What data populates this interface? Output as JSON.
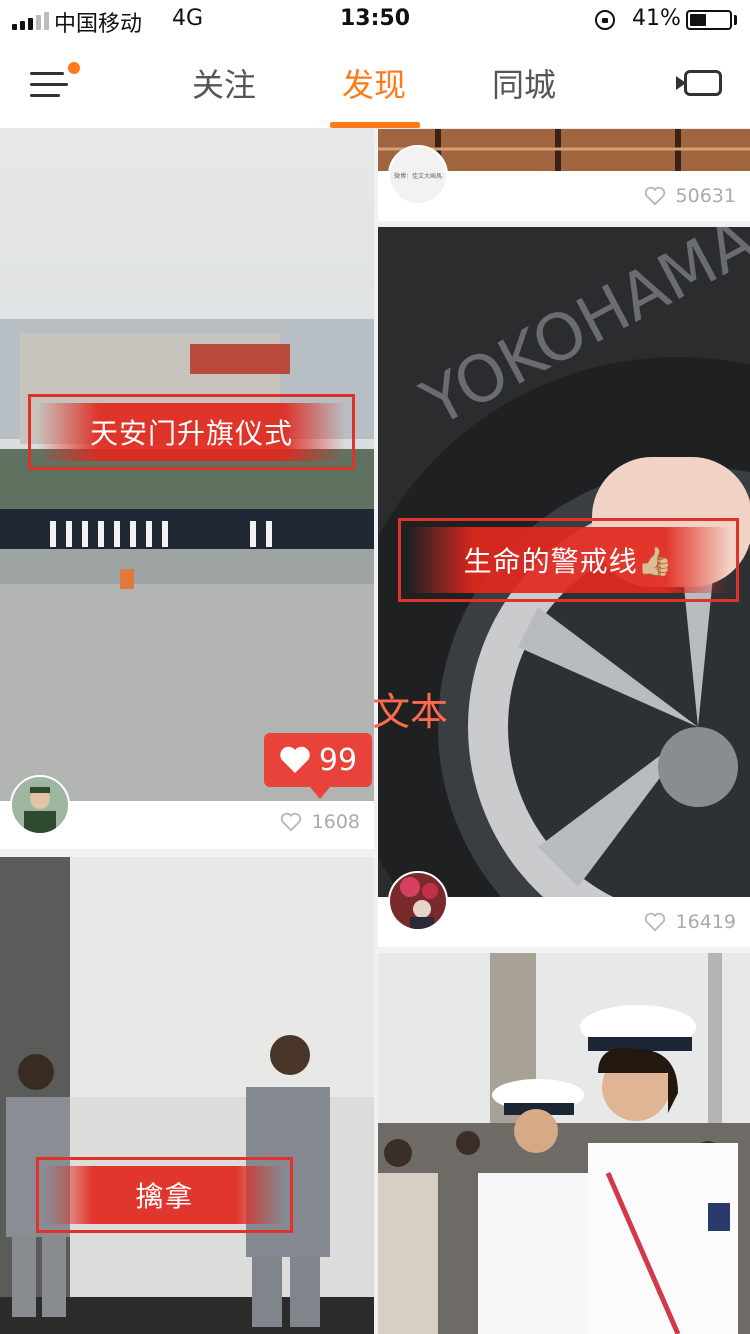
{
  "status_bar": {
    "carrier": "中国移动",
    "network": "4G",
    "time": "13:50",
    "battery_percent": "41%",
    "battery_level": 0.41
  },
  "nav": {
    "tabs": [
      {
        "label": "关注",
        "active": false
      },
      {
        "label": "发现",
        "active": true
      },
      {
        "label": "同城",
        "active": false
      }
    ],
    "accent_color": "#ff7a1a"
  },
  "feed": {
    "overlay_text": "文本",
    "cards": [
      {
        "label": "天安门升旗仪式",
        "likes": "1608",
        "hot_likes": "99"
      },
      {
        "likes": "50631",
        "avatar_caption": "微博：佳文大画馬"
      },
      {
        "label": "生命的警戒线👍🏼",
        "likes": "16419"
      },
      {
        "label": "擒拿"
      },
      {}
    ]
  },
  "icons": [
    "menu-icon",
    "notification-dot-icon",
    "cast-icon",
    "heart-icon",
    "lock-rotation-icon",
    "battery-icon",
    "signal-icon"
  ]
}
